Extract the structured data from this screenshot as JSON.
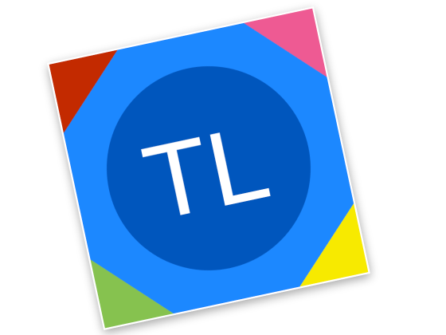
{
  "logo": {
    "text": "TL",
    "colors": {
      "frame": "#1E88FF",
      "circle": "#0556BD",
      "corner_top_left": "#C32A00",
      "corner_top_right": "#EE5A93",
      "corner_bottom_left": "#86C24F",
      "corner_bottom_right": "#F7EA00",
      "text": "#FFFFFF"
    }
  }
}
